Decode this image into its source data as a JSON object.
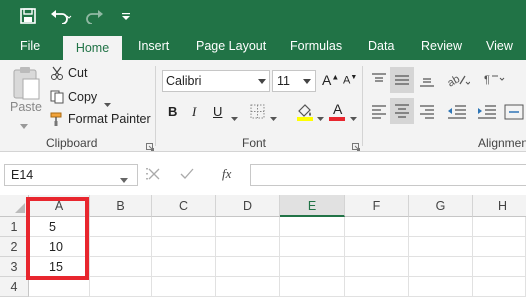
{
  "quick_access": {
    "save_icon": "save-icon",
    "undo_icon": "undo-icon",
    "redo_icon": "redo-icon",
    "customize_icon": "customize-dropdown-icon"
  },
  "tabs": [
    "File",
    "Home",
    "Insert",
    "Page Layout",
    "Formulas",
    "Data",
    "Review",
    "View"
  ],
  "active_tab": "Home",
  "clipboard": {
    "paste_label": "Paste",
    "cut_label": "Cut",
    "copy_label": "Copy",
    "format_painter_label": "Format Painter",
    "group_label": "Clipboard"
  },
  "font": {
    "font_name": "Calibri",
    "font_size": "11",
    "bold": "B",
    "italic": "I",
    "underline": "U",
    "font_color_letter": "A",
    "group_label": "Font"
  },
  "alignment": {
    "group_label": "Alignmen"
  },
  "formula_bar": {
    "name_box": "E14",
    "fx_label": "fx",
    "formula": ""
  },
  "sheet": {
    "columns": [
      "A",
      "B",
      "C",
      "D",
      "E",
      "F",
      "G",
      "H"
    ],
    "selected_column": "E",
    "rows": [
      {
        "num": "1",
        "a": "5"
      },
      {
        "num": "2",
        "a": "10"
      },
      {
        "num": "3",
        "a": "15"
      },
      {
        "num": "4",
        "a": ""
      }
    ]
  },
  "colors": {
    "excel_green": "#217346",
    "highlight": "#e8262e",
    "fill_color": "#ffff00",
    "font_color": "#e8262e"
  }
}
